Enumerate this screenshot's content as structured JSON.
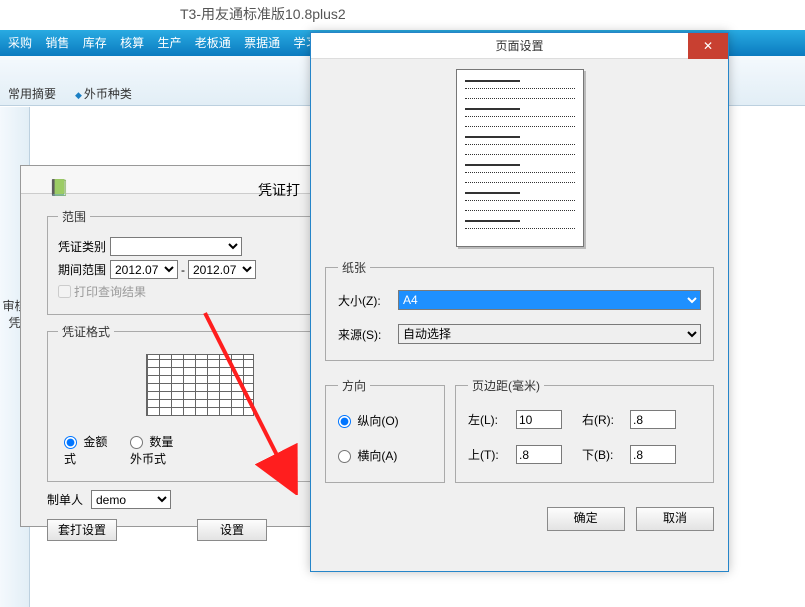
{
  "app_title": "T3-用友通标准版10.8plus2",
  "menubar": [
    "采购",
    "销售",
    "库存",
    "核算",
    "生产",
    "老板通",
    "票据通",
    "学习中"
  ],
  "shortcuts": [
    "常用摘要",
    "外币种类"
  ],
  "left_item": "审核凭",
  "voucher": {
    "title": "凭证打",
    "scope": {
      "legend": "范围",
      "type_label": "凭证类别",
      "type_value": "",
      "period_label": "期间范围",
      "period_from": "2012.07",
      "period_to": "2012.07",
      "print_query_result": "打印查询结果"
    },
    "format": {
      "legend": "凭证格式",
      "radio_amount": "金额式",
      "radio_qtyfx": "数量外币式"
    },
    "maker_label": "制单人",
    "maker_value": "demo",
    "btn_batch": "套打设置",
    "btn_setup": "设置"
  },
  "pagesetup": {
    "title": "页面设置",
    "paper": {
      "legend": "纸张",
      "size_label": "大小(Z):",
      "size_value": "A4",
      "source_label": "来源(S):",
      "source_value": "自动选择"
    },
    "orientation": {
      "legend": "方向",
      "portrait": "纵向(O)",
      "landscape": "横向(A)"
    },
    "margins": {
      "legend": "页边距(毫米)",
      "left_label": "左(L):",
      "left_value": "10",
      "right_label": "右(R):",
      "right_value": ".8",
      "top_label": "上(T):",
      "top_value": ".8",
      "bottom_label": "下(B):",
      "bottom_value": ".8"
    },
    "ok": "确定",
    "cancel": "取消"
  }
}
